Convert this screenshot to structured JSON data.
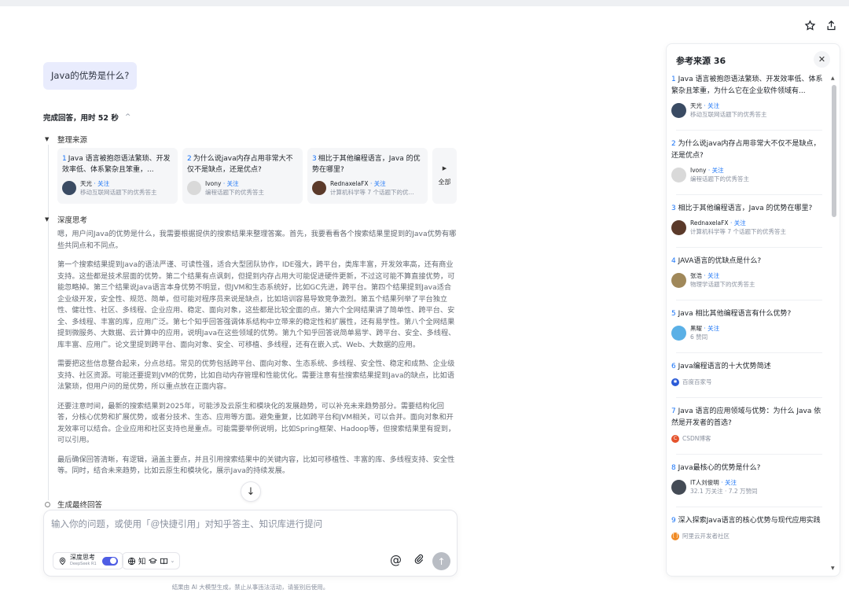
{
  "user_question": "Java的优势是什么?",
  "status": {
    "label": "完成回答，用时 52 秒",
    "chevron": "^"
  },
  "sections": {
    "sources_label": "整理来源",
    "thinking_label": "深度思考",
    "final_label": "生成最终回答"
  },
  "source_cards": [
    {
      "num": "1",
      "title": "Java 语言被抱怨语法繁琐、开发效率低、体系繁杂且笨重，...",
      "name": "天光",
      "follow": "· 关注",
      "sub": "移动互联网话题下的优秀答主"
    },
    {
      "num": "2",
      "title": "为什么说java内存占用非常大不仅不是缺点，还是优点?",
      "name": "Ivony",
      "follow": "· 关注",
      "sub": "编程话题下的优秀答主"
    },
    {
      "num": "3",
      "title": "相比于其他编程语言，Java 的优势在哪里?",
      "name": "RednaxelaFX",
      "follow": "· 关注",
      "sub": "计算机科学等 7 个话题下的优..."
    }
  ],
  "all_label": "全部",
  "thinking_paragraphs": [
    "嗯，用户问Java的优势是什么，我需要根据提供的搜索结果来整理答案。首先，我要看看各个搜索结果里提到的Java优势有哪些共同点和不同点。",
    "第一个搜索结果提到Java的语法严谨、可读性强，适合大型团队协作，IDE强大，跨平台，类库丰富，开发效率高，还有商业支持。这些都是技术层面的优势。第二个结果有点讽刺，但提到内存占用大可能促进硬件更新，不过这可能不算直接优势，可能忽略掉。第三个结果说Java语言本身优势不明显，但JVM和生态系统好，比如GC先进，跨平台。第四个结果提到Java适合企业级开发，安全性、规范、简单，但可能对程序员来说是缺点，比如培训容易导致竞争激烈。第五个结果列举了平台独立性、健壮性、社区、多线程、企业应用、稳定、面向对象，这些都是比较全面的点。第六个全网结果讲了简单性、跨平台、安全、多线程、丰富的库，应用广泛。第七个知乎回答强调体系结构中立带来的稳定性和扩展性，还有易学性。第八个全网结果提到微服务、大数据、云计算中的应用，说明Java在这些领域的优势。第九个知乎回答说简单易学、跨平台、安全、多线程、库丰富、应用广。论文里提到跨平台、面向对象、安全、可移植、多线程，还有在嵌入式、Web、大数据的应用。",
    "需要把这些信息整合起来，分点总结。常见的优势包括跨平台、面向对象、生态系统、多线程、安全性、稳定和成熟、企业级支持、社区资源。可能还要提到JVM的优势，比如自动内存管理和性能优化。需要注意有些搜索结果提到Java的缺点，比如语法繁琐，但用户问的是优势，所以重点放在正面内容。",
    "还要注意时间，最新的搜索结果到2025年，可能涉及云原生和模块化的发展趋势，可以补充未来趋势部分。需要结构化回答，分核心优势和扩展优势，或者分技术、生态、应用等方面。避免重复，比如跨平台和JVM相关，可以合并。面向对象和开发效率可以结合。企业应用和社区支持也是重点。可能需要举例说明，比如Spring框架、Hadoop等，但搜索结果里有提到，可以引用。",
    "最后确保回答清晰，有逻辑，涵盖主要点，并且引用搜索结果中的关键内容，比如可移植性、丰富的库、多线程支持、安全性等。同时，结合未来趋势，比如云原生和模块化，展示Java的持续发展。"
  ],
  "composer": {
    "placeholder": "输入你的问题，或使用「@快捷引用」对知乎答主、知识库进行提问",
    "deep_label": "深度思考",
    "deep_model": "DeepSeek R1",
    "tools": "知"
  },
  "disclaimer": "结果由 AI 大模型生成，禁止从事违法活动，请鉴别后使用。",
  "panel": {
    "title": "参考来源 36",
    "refs": [
      {
        "num": "1",
        "title": "Java 语言被抱怨语法繁琐、开发效率低、体系繁杂且笨重，为什么它在企业软件领域有...",
        "name": "天光",
        "follow": "· 关注",
        "sub": "移动互联网话题下的优秀答主",
        "kind": "user",
        "color": "#3a4b63"
      },
      {
        "num": "2",
        "title": "为什么说java内存占用非常大不仅不是缺点，还是优点?",
        "name": "Ivony",
        "follow": "· 关注",
        "sub": "编程话题下的优秀答主",
        "kind": "user",
        "color": "#d9d9d9"
      },
      {
        "num": "3",
        "title": "相比于其他编程语言，Java 的优势在哪里?",
        "name": "RednaxelaFX",
        "follow": "· 关注",
        "sub": "计算机科学等 7 个话题下的优秀答主",
        "kind": "user",
        "color": "#5b3a2a"
      },
      {
        "num": "4",
        "title": "JAVA语言的优缺点是什么?",
        "name": "张浩",
        "follow": "· 关注",
        "sub": "物理学话题下的优秀答主",
        "kind": "user",
        "color": "#a0885a"
      },
      {
        "num": "5",
        "title": "Java 相比其他编程语言有什么优势?",
        "name": "黑曜",
        "follow": "· 关注",
        "sub": "6 赞同",
        "kind": "user",
        "color": "#5ab0e6"
      },
      {
        "num": "6",
        "title": "Java编程语言的十大优势简述",
        "source": "百度百家号",
        "kind": "src",
        "color": "#2b5bd7"
      },
      {
        "num": "7",
        "title": "Java 语言的应用领域与优势：为什么 Java 依然是开发者的首选?",
        "source": "CSDN博客",
        "kind": "src",
        "color": "#e5532d"
      },
      {
        "num": "8",
        "title": "Java最核心的优势是什么?",
        "name": "IT人刘俊明",
        "follow": "· 关注",
        "sub": "32.1 万关注 · 7.2 万赞同",
        "kind": "user",
        "color": "#444b55"
      },
      {
        "num": "9",
        "title": "深入探索Java语言的核心优势与现代应用实践",
        "source": "阿里云开发者社区",
        "kind": "src",
        "color": "#f08a24"
      }
    ]
  },
  "colors": {
    "accent": "#1772f6",
    "toggle": "#4e5de4",
    "bubble": "#e9ecfd"
  }
}
